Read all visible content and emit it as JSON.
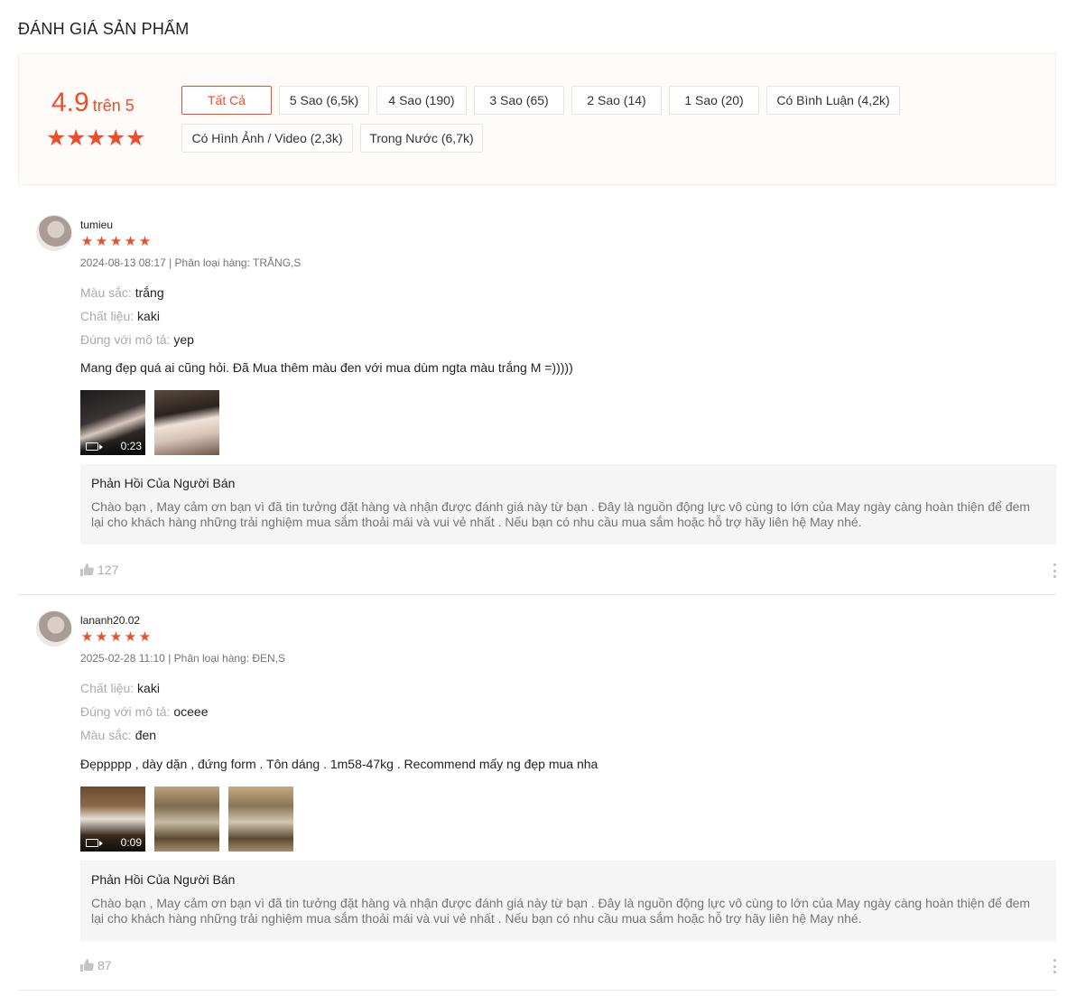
{
  "section_title": "ĐÁNH GIÁ SẢN PHẨM",
  "overview": {
    "score": "4.9",
    "score_suffix": "trên 5",
    "stars": 5,
    "filters": [
      {
        "label": "Tất Cả",
        "active": true
      },
      {
        "label": "5 Sao (6,5k)",
        "active": false
      },
      {
        "label": "4 Sao (190)",
        "active": false
      },
      {
        "label": "3 Sao (65)",
        "active": false
      },
      {
        "label": "2 Sao (14)",
        "active": false
      },
      {
        "label": "1 Sao (20)",
        "active": false
      },
      {
        "label": "Có Bình Luận (4,2k)",
        "active": false
      },
      {
        "label": "Có Hình Ảnh / Video (2,3k)",
        "active": false
      },
      {
        "label": "Trong Nước (6,7k)",
        "active": false
      }
    ]
  },
  "colors": {
    "accent": "#ee4d2d",
    "muted": "#757575",
    "reply_bg": "#f5f5f5"
  },
  "reviews": [
    {
      "author": "tumieu",
      "rating": 5,
      "meta": "2024-08-13 08:17 | Phân loại hàng: TRẮNG,S",
      "attributes": [
        {
          "key": "Màu sắc:",
          "value": "trắng"
        },
        {
          "key": "Chất liệu:",
          "value": "kaki"
        },
        {
          "key": "Đúng với mô tả:",
          "value": "yep"
        }
      ],
      "comment": "Mang đẹp quá ai cũng hỏi. Đã Mua thêm màu đen với mua dùm ngta màu trắng M =)))))",
      "media": [
        {
          "type": "video",
          "duration": "0:23",
          "icon": "video-camera-icon"
        },
        {
          "type": "image"
        }
      ],
      "seller_reply_title": "Phản Hồi Của Người Bán",
      "seller_reply": "Chào bạn , May cảm ơn bạn vì đã tin tưởng đặt hàng và nhận được đánh giá này từ bạn . Đây là nguồn động lực vô cùng to lớn của May ngày càng hoàn thiện để đem lại cho khách hàng những trải nghiệm mua sắm thoải mái và vui vẻ nhất . Nếu bạn có nhu cầu mua sắm hoặc hỗ trợ hãy liên hệ May nhé.",
      "likes": "127"
    },
    {
      "author": "lananh20.02",
      "rating": 5,
      "meta": "2025-02-28 11:10 | Phân loại hàng: ĐEN,S",
      "attributes": [
        {
          "key": "Chất liệu:",
          "value": "kaki"
        },
        {
          "key": "Đúng với mô tả:",
          "value": "oceee"
        },
        {
          "key": "Màu sắc:",
          "value": "đen"
        }
      ],
      "comment": "Đẹppppp , dày dặn , đứng form . Tôn dáng . 1m58-47kg . Recommend mấy ng đẹp mua nha",
      "media": [
        {
          "type": "video",
          "duration": "0:09",
          "icon": "video-camera-icon"
        },
        {
          "type": "image"
        },
        {
          "type": "image"
        }
      ],
      "seller_reply_title": "Phản Hồi Của Người Bán",
      "seller_reply": "Chào bạn , May cảm ơn bạn vì đã tin tưởng đặt hàng và nhận được đánh giá này từ bạn . Đây là nguồn động lực vô cùng to lớn của May ngày càng hoàn thiện để đem lại cho khách hàng những trải nghiệm mua sắm thoải mái và vui vẻ nhất . Nếu bạn có nhu cầu mua sắm hoặc hỗ trợ hãy liên hệ May nhé.",
      "likes": "87"
    }
  ]
}
